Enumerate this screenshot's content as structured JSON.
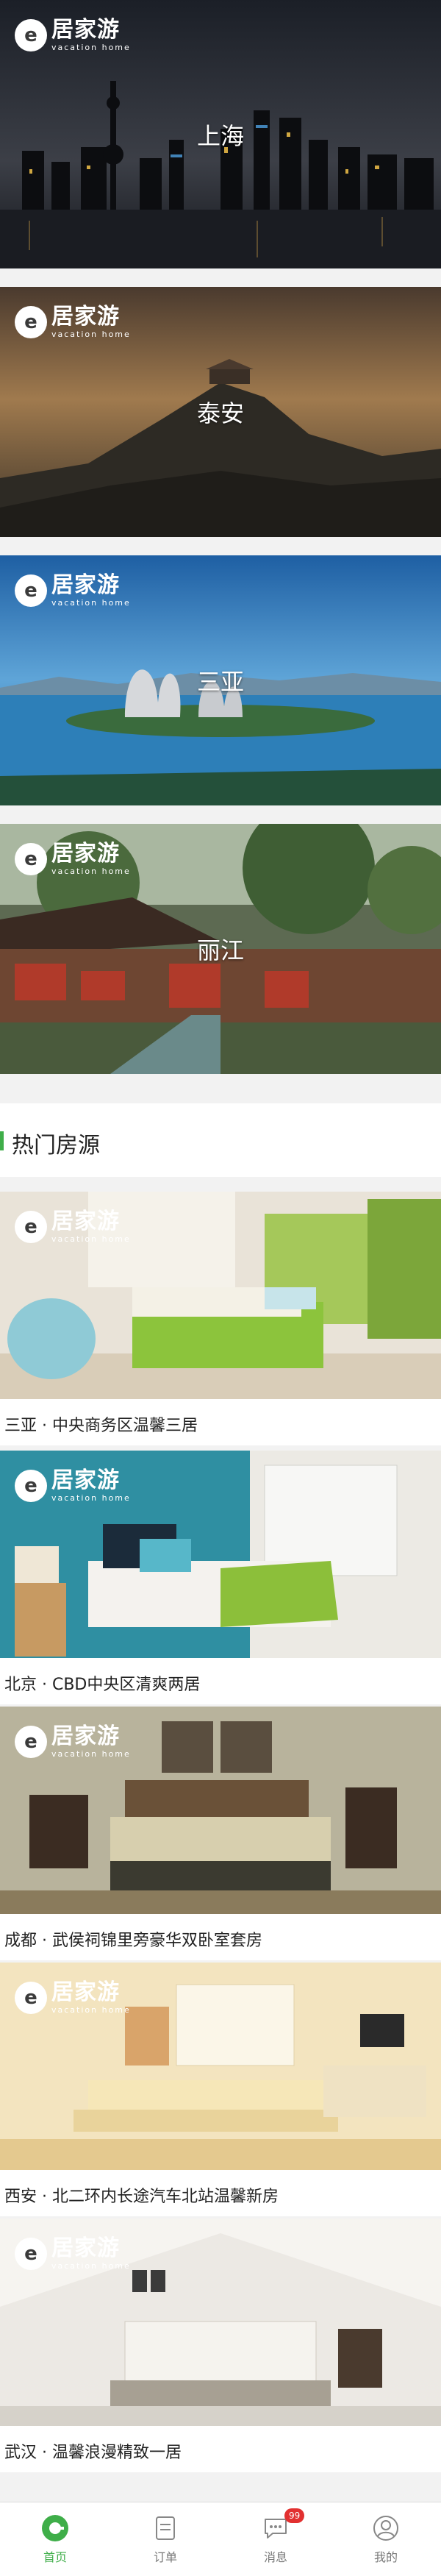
{
  "brand": {
    "cn": "居家游",
    "en": "vacation home"
  },
  "cities": [
    {
      "name": "上海"
    },
    {
      "name": "泰安"
    },
    {
      "name": "三亚"
    },
    {
      "name": "丽江"
    }
  ],
  "section": {
    "title": "热门房源"
  },
  "listings": [
    {
      "caption": "三亚 · 中央商务区温馨三居"
    },
    {
      "caption": "北京 · CBD中央区清爽两居"
    },
    {
      "caption": "成都 · 武侯祠锦里旁豪华双卧室套房"
    },
    {
      "caption": "西安 · 北二环内长途汽车北站温馨新房"
    },
    {
      "caption": "武汉 · 温馨浪漫精致一居"
    }
  ],
  "tabbar": {
    "items": [
      {
        "label": "首页",
        "icon": "home-icon"
      },
      {
        "label": "订单",
        "icon": "order-icon"
      },
      {
        "label": "消息",
        "icon": "message-icon",
        "badge": "99"
      },
      {
        "label": "我的",
        "icon": "profile-icon"
      }
    ]
  },
  "colors": {
    "accent": "#3fae49",
    "badge": "#e23030"
  }
}
